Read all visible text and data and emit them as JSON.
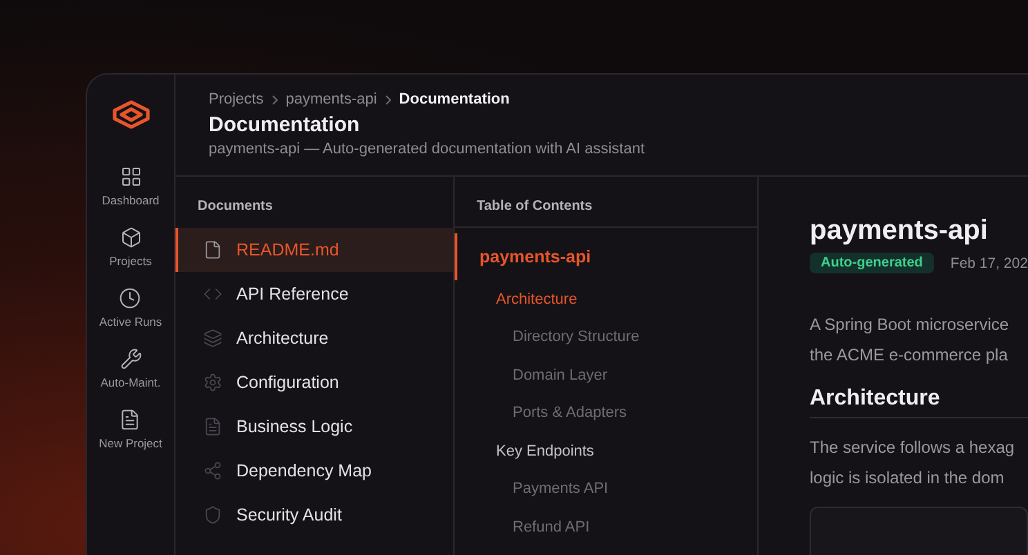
{
  "nav": [
    {
      "label": "Dashboard"
    },
    {
      "label": "Projects"
    },
    {
      "label": "Active Runs"
    },
    {
      "label": "Auto-Maint."
    },
    {
      "label": "New Project"
    }
  ],
  "breadcrumbs": [
    {
      "label": "Projects",
      "current": false
    },
    {
      "label": "payments-api",
      "current": false
    },
    {
      "label": "Documentation",
      "current": true
    }
  ],
  "page_title": "Documentation",
  "page_subtitle": "payments-api — Auto-generated documentation with AI assistant",
  "documents": {
    "heading": "Documents",
    "items": [
      {
        "label": "README.md",
        "selected": true
      },
      {
        "label": "API Reference",
        "selected": false
      },
      {
        "label": "Architecture",
        "selected": false
      },
      {
        "label": "Configuration",
        "selected": false
      },
      {
        "label": "Business Logic",
        "selected": false
      },
      {
        "label": "Dependency Map",
        "selected": false
      },
      {
        "label": "Security Audit",
        "selected": false
      }
    ]
  },
  "toc": {
    "heading": "Table of Contents",
    "items": [
      {
        "label": "payments-api",
        "selected": true,
        "children": [
          {
            "label": "Architecture",
            "selected": true,
            "children": [
              {
                "label": "Directory Structure",
                "selected": false
              },
              {
                "label": "Domain Layer",
                "selected": false
              },
              {
                "label": "Ports & Adapters",
                "selected": false
              }
            ]
          },
          {
            "label": "Key Endpoints",
            "selected": false,
            "children": [
              {
                "label": "Payments API",
                "selected": false
              },
              {
                "label": "Refund API",
                "selected": false
              }
            ]
          }
        ]
      }
    ]
  },
  "content": {
    "title": "payments-api",
    "badge": "Auto-generated",
    "date": "Feb 17, 202",
    "intro": [
      "A Spring Boot microservice",
      "the ACME e-commerce pla"
    ],
    "section_title": "Architecture",
    "section_text": [
      "The service follows a hexag",
      "logic is isolated in the dom"
    ]
  }
}
